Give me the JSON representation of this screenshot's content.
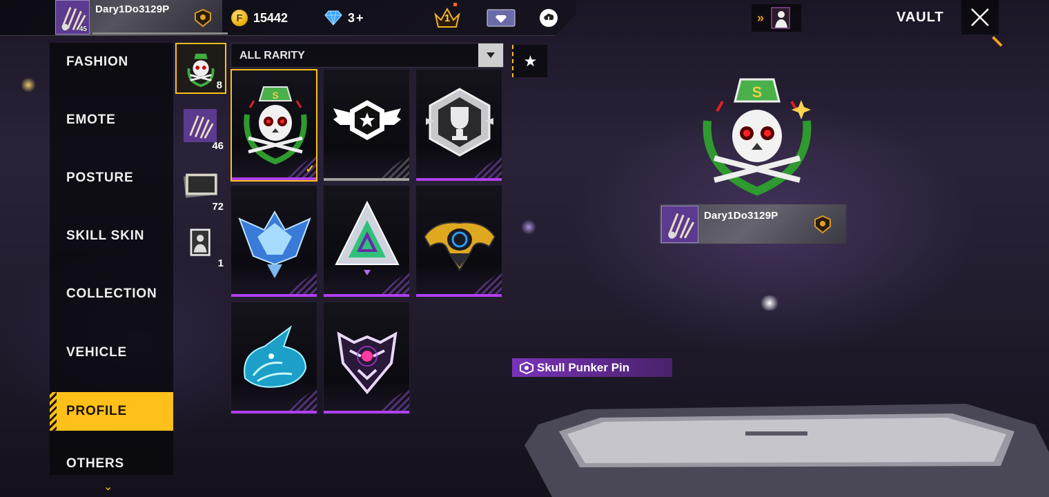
{
  "player": {
    "name": "Dary1Do3129P",
    "level": "45"
  },
  "currency": {
    "gold": "15442",
    "diamonds": "3",
    "diamonds_add": "+"
  },
  "top_icons": {
    "rank_number": "1"
  },
  "header": {
    "title": "VAULT"
  },
  "nav": {
    "items": [
      {
        "label": "FASHION"
      },
      {
        "label": "EMOTE"
      },
      {
        "label": "POSTURE"
      },
      {
        "label": "SKILL SKIN"
      },
      {
        "label": "COLLECTION"
      },
      {
        "label": "VEHICLE"
      },
      {
        "label": "PROFILE",
        "active": true
      },
      {
        "label": "OTHERS"
      }
    ]
  },
  "subtabs": [
    {
      "icon": "pin-icon",
      "count": "8",
      "active": true
    },
    {
      "icon": "avatar-icon",
      "count": "46"
    },
    {
      "icon": "banner-icon",
      "count": "72"
    },
    {
      "icon": "profile-card-icon",
      "count": "1"
    }
  ],
  "filter": {
    "label": "ALL RARITY"
  },
  "grid": {
    "items": [
      {
        "icon": "skull-punker-pin-icon",
        "selected": true,
        "equipped": true,
        "rarity_color": "#b040f0"
      },
      {
        "icon": "winged-star-badge-icon",
        "rarity_color": "#a0a0a0"
      },
      {
        "icon": "silver-trophy-hexagon-icon",
        "rarity_color": "#b040f0"
      },
      {
        "icon": "crystal-wings-badge-icon",
        "rarity_color": "#b040f0"
      },
      {
        "icon": "neon-triangle-badge-icon",
        "rarity_color": "#b040f0"
      },
      {
        "icon": "gold-tech-emblem-icon",
        "rarity_color": "#b040f0"
      },
      {
        "icon": "cyan-dragon-head-icon",
        "rarity_color": "#b040f0"
      },
      {
        "icon": "tiger-face-icon",
        "rarity_color": "#b040f0"
      }
    ]
  },
  "preview": {
    "item_name": "Skull Punker Pin"
  },
  "colors": {
    "accent": "#ffc01a",
    "rarity_purple": "#b040f0"
  }
}
